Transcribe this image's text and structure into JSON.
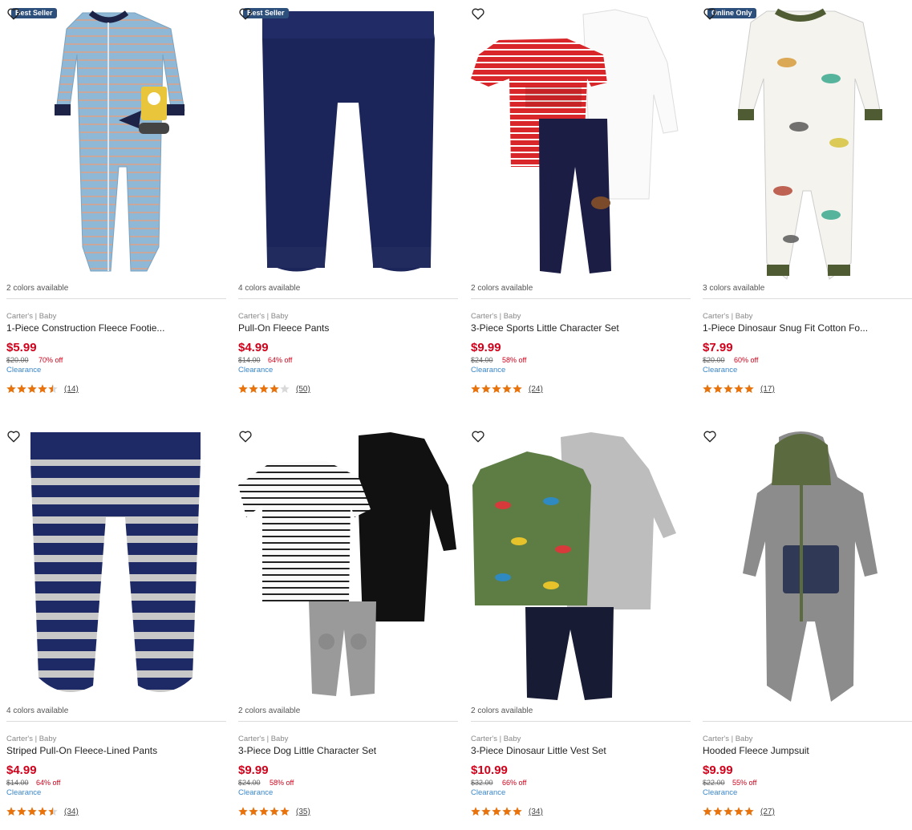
{
  "products": [
    {
      "badge": "Best Seller",
      "colors_available": "2 colors available",
      "brand": "Carter's | Baby",
      "title": "1-Piece Construction Fleece Footie...",
      "price": "$5.99",
      "original_price": "$20.00",
      "discount": "70% off",
      "clearance": "Clearance",
      "rating": 4.5,
      "reviews": "(14)",
      "image": "striped-fleece-footie"
    },
    {
      "badge": "Best Seller",
      "colors_available": "4 colors available",
      "brand": "Carter's | Baby",
      "title": "Pull-On Fleece Pants",
      "price": "$4.99",
      "original_price": "$14.00",
      "discount": "64% off",
      "clearance": "Clearance",
      "rating": 4,
      "reviews": "(50)",
      "image": "navy-fleece-pants"
    },
    {
      "badge": "",
      "colors_available": "2 colors available",
      "brand": "Carter's | Baby",
      "title": "3-Piece Sports Little Character Set",
      "price": "$9.99",
      "original_price": "$24.00",
      "discount": "58% off",
      "clearance": "Clearance",
      "rating": 5,
      "reviews": "(24)",
      "image": "sports-character-set"
    },
    {
      "badge": "Online Only",
      "colors_available": "3 colors available",
      "brand": "Carter's | Baby",
      "title": "1-Piece Dinosaur Snug Fit Cotton Fo...",
      "price": "$7.99",
      "original_price": "$20.00",
      "discount": "60% off",
      "clearance": "Clearance",
      "rating": 5,
      "reviews": "(17)",
      "image": "dinosaur-snug-fit"
    },
    {
      "badge": "",
      "colors_available": "4 colors available",
      "brand": "Carter's | Baby",
      "title": "Striped Pull-On Fleece-Lined Pants",
      "price": "$4.99",
      "original_price": "$14.00",
      "discount": "64% off",
      "clearance": "Clearance",
      "rating": 4.5,
      "reviews": "(34)",
      "image": "striped-pants"
    },
    {
      "badge": "",
      "colors_available": "2 colors available",
      "brand": "Carter's | Baby",
      "title": "3-Piece Dog Little Character Set",
      "price": "$9.99",
      "original_price": "$24.00",
      "discount": "58% off",
      "clearance": "Clearance",
      "rating": 5,
      "reviews": "(35)",
      "image": "dog-character-set"
    },
    {
      "badge": "",
      "colors_available": "2 colors available",
      "brand": "Carter's | Baby",
      "title": "3-Piece Dinosaur Little Vest Set",
      "price": "$10.99",
      "original_price": "$32.00",
      "discount": "66% off",
      "clearance": "Clearance",
      "rating": 5,
      "reviews": "(34)",
      "image": "dinosaur-vest-set"
    },
    {
      "badge": "",
      "colors_available": "",
      "brand": "Carter's | Baby",
      "title": "Hooded Fleece Jumpsuit",
      "price": "$9.99",
      "original_price": "$22.00",
      "discount": "55% off",
      "clearance": "Clearance",
      "rating": 5,
      "reviews": "(27)",
      "image": "hooded-fleece-jumpsuit"
    }
  ],
  "colors": {
    "price_red": "#d0021b",
    "clearance_blue": "#3a87c8",
    "star_orange": "#e8730c",
    "badge_navy": "#2d4f7c"
  }
}
